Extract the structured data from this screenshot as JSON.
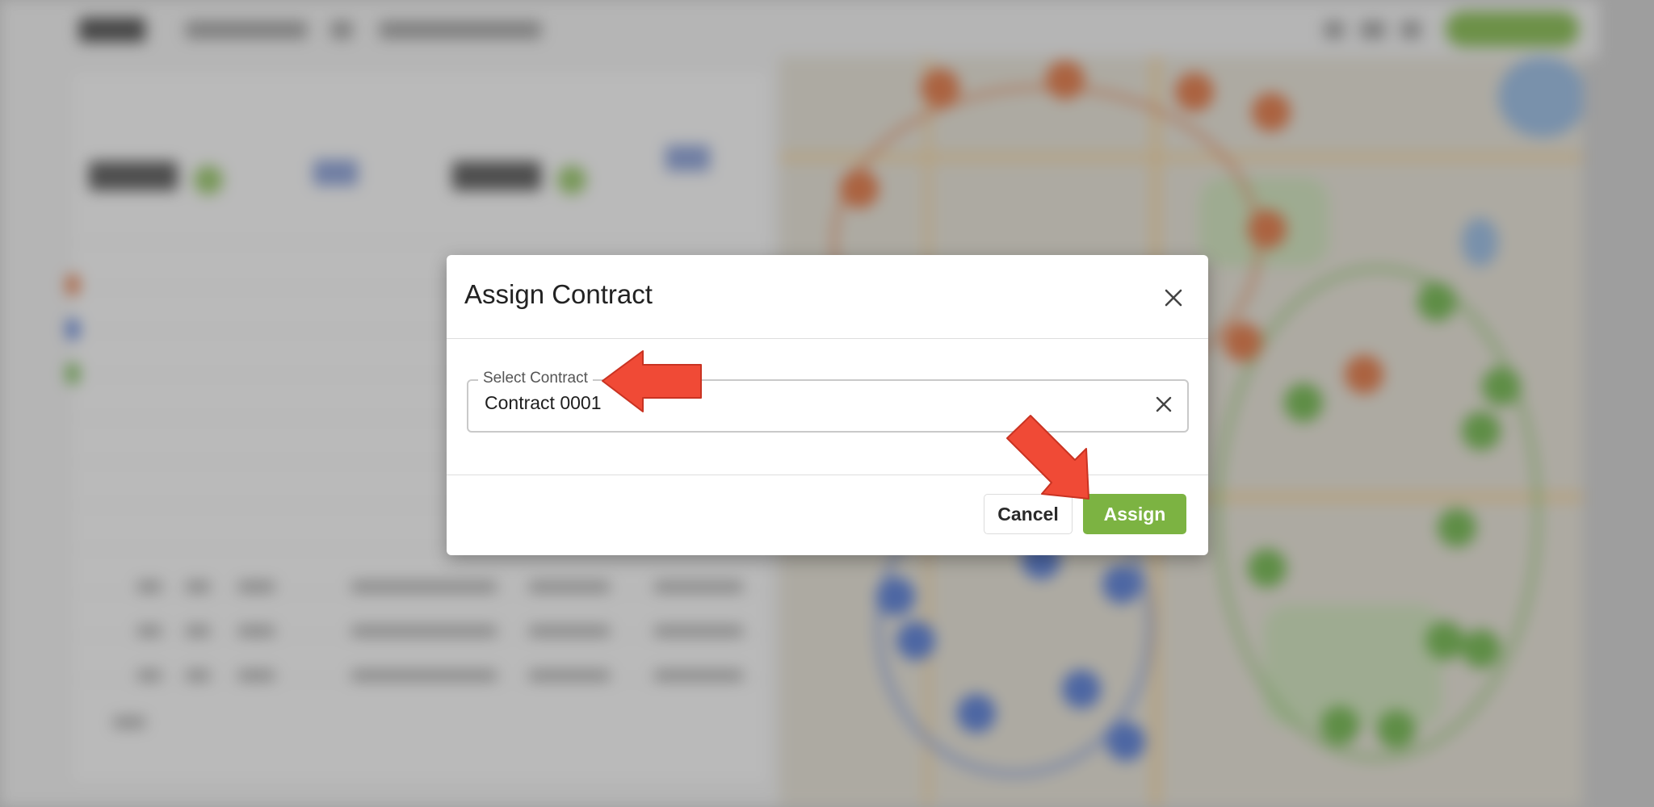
{
  "modal": {
    "title": "Assign Contract",
    "field_label": "Select Contract",
    "field_value": "Contract 0001",
    "cancel_label": "Cancel",
    "assign_label": "Assign"
  },
  "icons": {
    "close": "close-icon",
    "clear": "clear-icon",
    "annotation": "red-arrow-icon"
  },
  "colors": {
    "assign_button": "#7cb342",
    "annotation_arrow": "#f04a36",
    "route_orange": "#e6692e",
    "route_green": "#62b338",
    "route_blue": "#4470d8"
  }
}
